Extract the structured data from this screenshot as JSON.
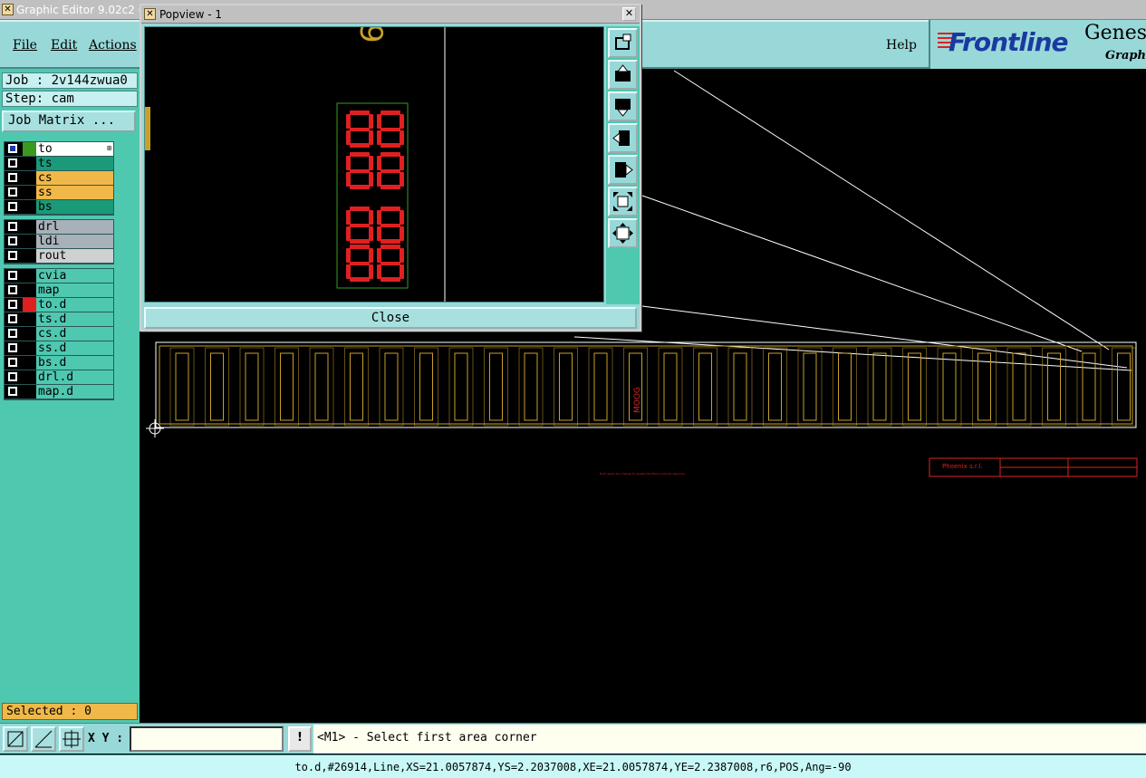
{
  "window": {
    "title": "Graphic Editor 9.02c2 (0"
  },
  "menubar": {
    "file": "File",
    "edit": "Edit",
    "actions": "Actions",
    "help": "Help"
  },
  "logo": {
    "brand": "Frontline",
    "product": "Genesi",
    "tagline": "Graphic"
  },
  "left_panel": {
    "job": "Job : 2v144zwua0",
    "step": "Step: cam",
    "job_matrix": "Job Matrix ...",
    "selected": "Selected : 0",
    "layer_groups": [
      [
        {
          "name": "to",
          "color": "#ffffff",
          "swatch": "#3a9a20",
          "active": true
        },
        {
          "name": "ts",
          "color": "#1a9a78",
          "swatch": "#000000",
          "active": false
        },
        {
          "name": "cs",
          "color": "#f0b848",
          "swatch": "#000000",
          "active": false
        },
        {
          "name": "ss",
          "color": "#f0b848",
          "swatch": "#000000",
          "active": false
        },
        {
          "name": "bs",
          "color": "#1a9a78",
          "swatch": "#000000",
          "active": false
        }
      ],
      [
        {
          "name": "drl",
          "color": "#a8b0b8",
          "swatch": "#000000",
          "active": false
        },
        {
          "name": "ldi",
          "color": "#a8b0b8",
          "swatch": "#000000",
          "active": false
        },
        {
          "name": "rout",
          "color": "#d0d0d0",
          "swatch": "#000000",
          "active": false
        }
      ],
      [
        {
          "name": "cvia",
          "color": "#4fc8b0",
          "swatch": "#000000",
          "active": false
        },
        {
          "name": "map",
          "color": "#4fc8b0",
          "swatch": "#000000",
          "active": false
        },
        {
          "name": "to.d",
          "color": "#4fc8b0",
          "swatch": "#e02020",
          "active": false
        },
        {
          "name": "ts.d",
          "color": "#4fc8b0",
          "swatch": "#000000",
          "active": false
        },
        {
          "name": "cs.d",
          "color": "#4fc8b0",
          "swatch": "#000000",
          "active": false
        },
        {
          "name": "ss.d",
          "color": "#4fc8b0",
          "swatch": "#000000",
          "active": false
        },
        {
          "name": "bs.d",
          "color": "#4fc8b0",
          "swatch": "#000000",
          "active": false
        },
        {
          "name": "drl.d",
          "color": "#4fc8b0",
          "swatch": "#000000",
          "active": false
        },
        {
          "name": "map.d",
          "color": "#4fc8b0",
          "swatch": "#000000",
          "active": false
        }
      ]
    ]
  },
  "bottom": {
    "xy_label": "X Y :",
    "xy_value": "",
    "alert": "!",
    "prompt": "<M1> - Select first area corner",
    "status": "to.d,#26914,Line,XS=21.0057874,YS=2.2037008,XE=21.0057874,YE=2.2387008,r6,POS,Ang=-90"
  },
  "popview": {
    "title": "Popview - 1",
    "close_label": "Close",
    "glyph": "9",
    "side_icons": [
      "zoom-fit-icon",
      "pan-up-icon",
      "pan-down-icon",
      "pan-left-icon",
      "pan-right-icon",
      "zoom-out-icon",
      "zoom-in-icon"
    ]
  },
  "canvas": {
    "company": "Phoenix s.r.l.",
    "part_label": "MOOG",
    "footnote": "Each apply any change to update the filled customer approval"
  },
  "colors": {
    "accent": "#98d8d8",
    "panel": "#4fc8b0",
    "trace": "#c8a028",
    "highlight": "#e02020"
  }
}
